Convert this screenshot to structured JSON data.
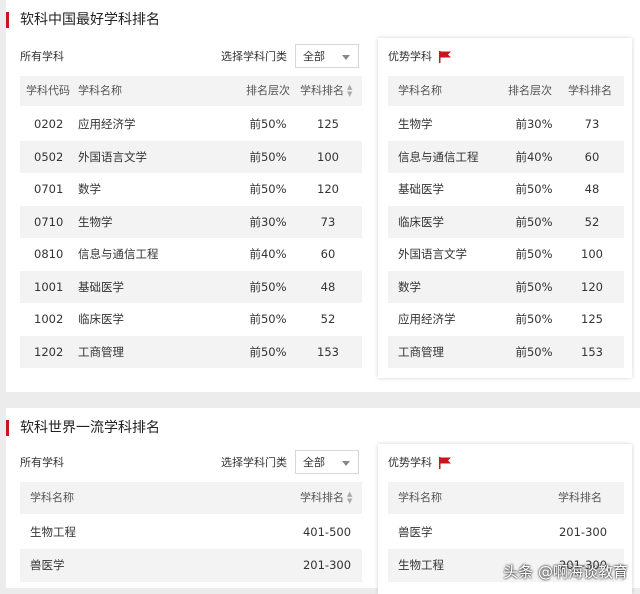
{
  "section1": {
    "title": "软科中国最好学科排名",
    "all_label": "所有学科",
    "select_label": "选择学科门类",
    "select_value": "全部",
    "headers": [
      "学科代码",
      "学科名称",
      "排名层次",
      "学科排名"
    ],
    "rows": [
      [
        "0202",
        "应用经济学",
        "前50%",
        "125"
      ],
      [
        "0502",
        "外国语言文学",
        "前50%",
        "100"
      ],
      [
        "0701",
        "数学",
        "前50%",
        "120"
      ],
      [
        "0710",
        "生物学",
        "前30%",
        "73"
      ],
      [
        "0810",
        "信息与通信工程",
        "前40%",
        "60"
      ],
      [
        "1001",
        "基础医学",
        "前50%",
        "48"
      ],
      [
        "1002",
        "临床医学",
        "前50%",
        "52"
      ],
      [
        "1202",
        "工商管理",
        "前50%",
        "153"
      ]
    ],
    "advantage_label": "优势学科",
    "adv_headers": [
      "学科名称",
      "排名层次",
      "学科排名"
    ],
    "adv_rows": [
      [
        "生物学",
        "前30%",
        "73"
      ],
      [
        "信息与通信工程",
        "前40%",
        "60"
      ],
      [
        "基础医学",
        "前50%",
        "48"
      ],
      [
        "临床医学",
        "前50%",
        "52"
      ],
      [
        "外国语言文学",
        "前50%",
        "100"
      ],
      [
        "数学",
        "前50%",
        "120"
      ],
      [
        "应用经济学",
        "前50%",
        "125"
      ],
      [
        "工商管理",
        "前50%",
        "153"
      ]
    ]
  },
  "section2": {
    "title": "软科世界一流学科排名",
    "all_label": "所有学科",
    "select_label": "选择学科门类",
    "select_value": "全部",
    "headers": [
      "学科名称",
      "学科排名"
    ],
    "rows": [
      [
        "生物工程",
        "401-500"
      ],
      [
        "兽医学",
        "201-300"
      ]
    ],
    "advantage_label": "优势学科",
    "adv_headers": [
      "学科名称",
      "学科排名"
    ],
    "adv_rows": [
      [
        "兽医学",
        "201-300"
      ],
      [
        "生物工程",
        "201-300"
      ]
    ]
  },
  "watermark": "头条 @啊海谈教育",
  "colors": {
    "accent": "#c8161e",
    "shade": "#f3f3f3",
    "background": "#ececec"
  }
}
